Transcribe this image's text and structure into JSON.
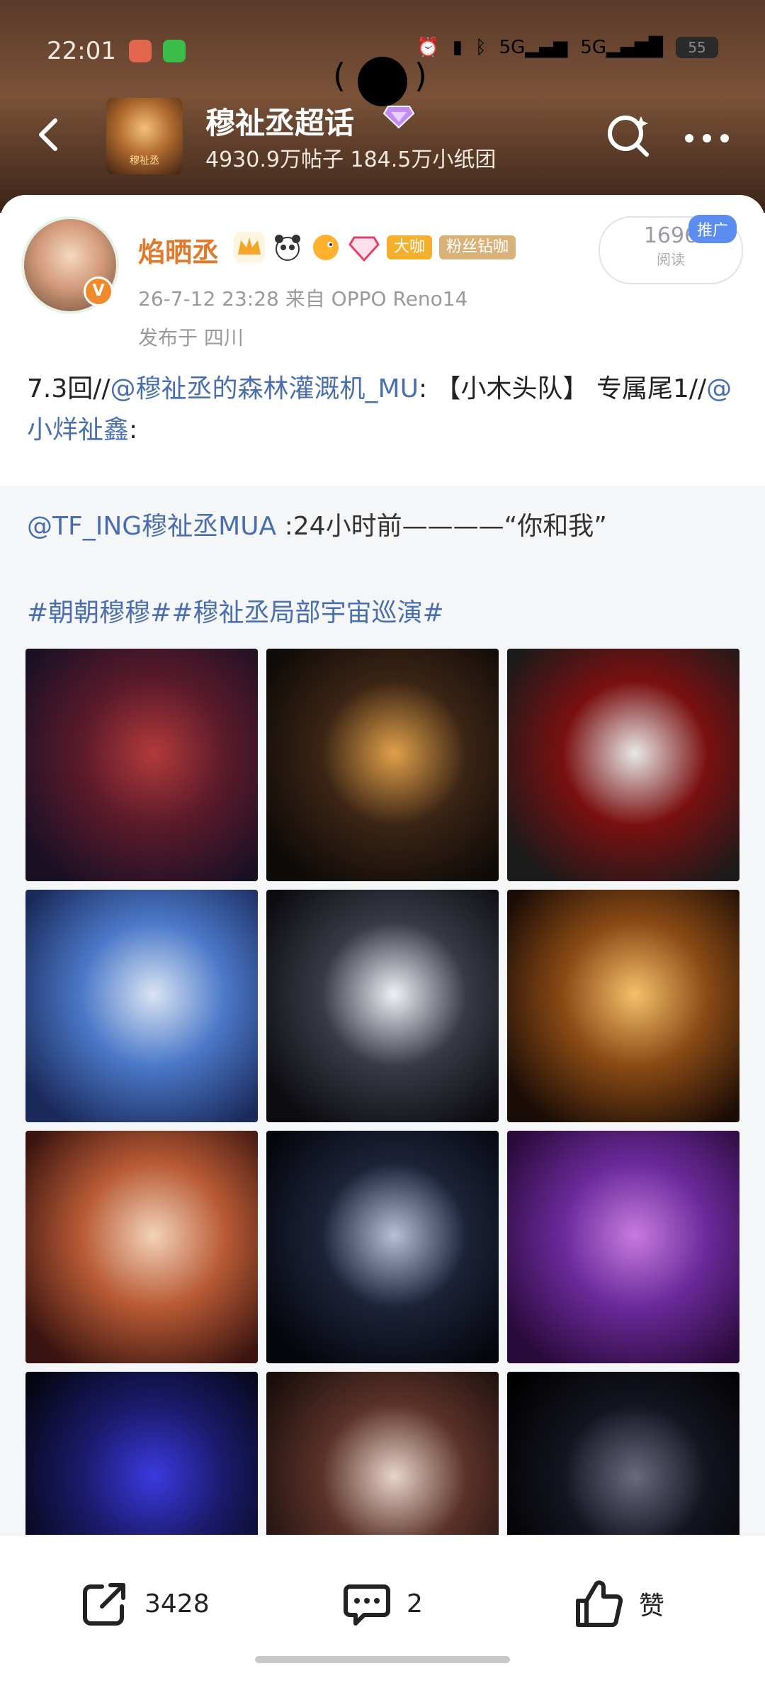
{
  "status_bar": {
    "time": "22:01",
    "battery": "55"
  },
  "topic": {
    "title": "穆祉丞超话",
    "stats": "4930.9万帖子  184.5万小纸团",
    "thumb_label": "穆祉丞"
  },
  "post": {
    "username": "焰晒丞",
    "badge_tags": [
      "大咖",
      "粉丝钻咖"
    ],
    "meta": "26-7-12 23:28   来自 OPPO Reno14",
    "location": "发布于 四川",
    "read_count": "1696",
    "read_label": "阅读",
    "promo_label": "推广",
    "text_prefix": "7.3回//",
    "mention1": "@穆祉丞的森林灌溉机_MU",
    "text_middle": ": 【小木头队】 专属尾1//",
    "mention2": "@小烊祉鑫",
    "text_suffix": ":"
  },
  "quote": {
    "mention": "@TF_ING穆祉丞MUA",
    "text": " :24小时前————“你和我”",
    "hashtags": "#朝朝穆穆##穆祉丞局部宇宙巡演#"
  },
  "grid_images": [
    {
      "name": "concert-photo-1",
      "colors": [
        "#1a1024",
        "#5b1a2a",
        "#b23a3a"
      ]
    },
    {
      "name": "concert-photo-2",
      "colors": [
        "#0d0a08",
        "#3b2414",
        "#e0a04a"
      ]
    },
    {
      "name": "concert-photo-3",
      "colors": [
        "#1a1a1a",
        "#7a1010",
        "#e8e8e8"
      ]
    },
    {
      "name": "concert-photo-4",
      "colors": [
        "#1b2a5a",
        "#4a78c8",
        "#d9e4f4"
      ]
    },
    {
      "name": "concert-photo-5",
      "colors": [
        "#0b0b10",
        "#3a3a46",
        "#f0f0f8"
      ]
    },
    {
      "name": "concert-photo-6",
      "colors": [
        "#1a0c06",
        "#8a4a14",
        "#f4c06a"
      ]
    },
    {
      "name": "concert-photo-7",
      "colors": [
        "#3a1410",
        "#b85a34",
        "#f3d2b8"
      ]
    },
    {
      "name": "concert-photo-8",
      "colors": [
        "#05060c",
        "#1c2238",
        "#b8bed8"
      ]
    },
    {
      "name": "concert-photo-9",
      "colors": [
        "#2a0a3a",
        "#6a2a9a",
        "#c87ae0"
      ]
    },
    {
      "name": "concert-photo-10",
      "colors": [
        "#050510",
        "#1a1a6a",
        "#3a3ae0"
      ]
    },
    {
      "name": "concert-photo-11",
      "colors": [
        "#1a0e0c",
        "#5a3228",
        "#e8d4c8"
      ]
    },
    {
      "name": "concert-photo-12",
      "colors": [
        "#000000",
        "#141420",
        "#6a6a80"
      ]
    }
  ],
  "actions": {
    "share_count": "3428",
    "comment_count": "2",
    "like_label": "赞"
  }
}
